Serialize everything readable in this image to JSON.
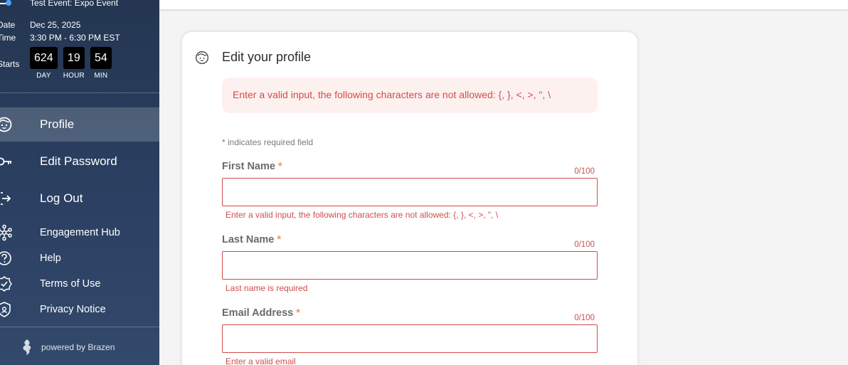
{
  "event": {
    "title": "Test Event: Expo Event",
    "date_label": "Date",
    "date_value": "Dec 25, 2025",
    "time_label": "Time",
    "time_value": "3:30 PM - 6:30 PM EST",
    "starts_label": "Starts",
    "countdown": [
      {
        "value": "624",
        "unit": "DAY"
      },
      {
        "value": "19",
        "unit": "HOUR"
      },
      {
        "value": "54",
        "unit": "MIN"
      }
    ]
  },
  "sidebar": {
    "primary": [
      {
        "label": "Profile",
        "icon": "face-icon",
        "active": true
      },
      {
        "label": "Edit Password",
        "icon": "key-icon"
      },
      {
        "label": "Log Out",
        "icon": "logout-icon"
      }
    ],
    "secondary": [
      {
        "label": "Engagement Hub",
        "icon": "network-icon"
      },
      {
        "label": "Help",
        "icon": "help-icon"
      },
      {
        "label": "Terms of Use",
        "icon": "badge-check-icon"
      },
      {
        "label": "Privacy Notice",
        "icon": "shield-icon"
      }
    ],
    "powered_by": "powered by Brazen"
  },
  "profile": {
    "title": "Edit your profile",
    "alert": "Enter a valid input, the following characters are not allowed: {, }, <, >, \", \\",
    "required_note": "* indicates required field",
    "fields": [
      {
        "label": "First Name",
        "required_mark": "*",
        "count": "0/100",
        "value": "",
        "error": "Enter a valid input, the following characters are not allowed: {, }, <, >, \", \\"
      },
      {
        "label": "Last Name",
        "required_mark": "*",
        "count": "0/100",
        "value": "",
        "error": "Last name is required"
      },
      {
        "label": "Email Address",
        "required_mark": "*",
        "count": "0/100",
        "value": "",
        "error": "Enter a valid email"
      }
    ]
  },
  "colors": {
    "sidebar_top": "#243651",
    "sidebar_bottom": "#33496c",
    "error": "#d24c4c",
    "alert_bg": "#fdf1f0",
    "required_star": "#e69a68"
  }
}
